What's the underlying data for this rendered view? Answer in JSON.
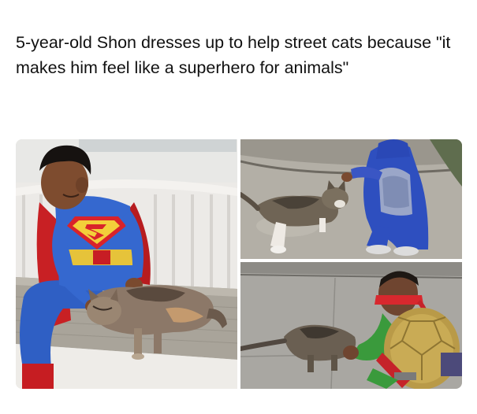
{
  "post": {
    "caption": "5-year-old Shon dresses up to help street cats because \"it makes him feel like a superhero for animals\""
  },
  "photos": [
    {
      "subject": "superman-costume-boy-petting-cat"
    },
    {
      "subject": "batman-costume-boy-petting-cat"
    },
    {
      "subject": "ninja-turtle-costume-boy-petting-cat"
    }
  ]
}
